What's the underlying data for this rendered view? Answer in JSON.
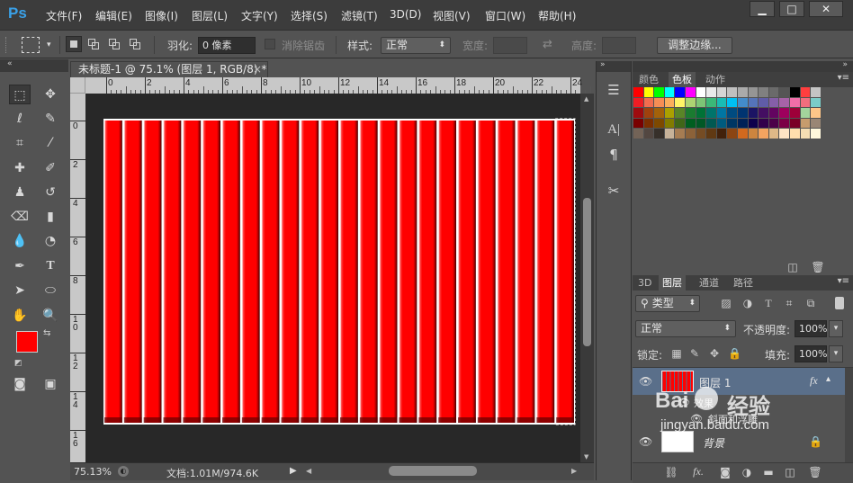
{
  "app": {
    "logo": "Ps"
  },
  "menu": [
    "文件(F)",
    "编辑(E)",
    "图像(I)",
    "图层(L)",
    "文字(Y)",
    "选择(S)",
    "滤镜(T)",
    "3D(D)",
    "视图(V)",
    "窗口(W)",
    "帮助(H)"
  ],
  "window_controls": {
    "minimize": "▁",
    "maximize": "□",
    "close": "✕"
  },
  "options": {
    "feather_label": "羽化:",
    "feather_value": "0 像素",
    "antialias_label": "消除锯齿",
    "style_label": "样式:",
    "style_value": "正常",
    "width_label": "宽度:",
    "height_label": "高度:",
    "refine_edge": "调整边缘..."
  },
  "document": {
    "tab_title": "未标题-1 @ 75.1% (图层 1, RGB/8) *",
    "zoom": "75.13%",
    "doc_info": "文档:1.01M/974.6K",
    "ruler_h": [
      "0",
      "2",
      "4",
      "6",
      "8",
      "10",
      "12",
      "14",
      "16",
      "18",
      "20",
      "22",
      "24"
    ],
    "ruler_v": [
      "0",
      "2",
      "4",
      "6",
      "8",
      "1 0",
      "1 2",
      "1 4",
      "1 6"
    ],
    "stripe_color": "#ff0000",
    "stripe_count": 24
  },
  "panels": {
    "swatches_tabs": [
      "颜色",
      "色板",
      "动作"
    ],
    "layers_tabs": [
      "3D",
      "图层",
      "通道",
      "路径"
    ],
    "kind_filter": "类型",
    "blend_mode": "正常",
    "opacity_label": "不透明度:",
    "opacity_value": "100%",
    "lock_label": "锁定:",
    "fill_label": "填充:",
    "fill_value": "100%",
    "layers": [
      {
        "name": "图层 1",
        "fx": "fx"
      },
      {
        "name": "效果"
      },
      {
        "name": "斜面和浮雕"
      },
      {
        "name": "背景"
      }
    ]
  },
  "colors": {
    "foreground": "#ff0000",
    "background": "#ffffff",
    "swatches": [
      "#ff0000",
      "#ffff00",
      "#00ff00",
      "#00ffff",
      "#0000ff",
      "#ff00ff",
      "#ffffff",
      "#eaeaea",
      "#d5d5d5",
      "#c0c0c0",
      "#aaaaaa",
      "#959595",
      "#808080",
      "#6a6a6a",
      "#555555",
      "#000000",
      "#ff3e3e",
      "#c4c4c4",
      "#ee1d24",
      "#f26c4f",
      "#f68e55",
      "#fbaf5c",
      "#fff467",
      "#acd372",
      "#7cc576",
      "#3bb878",
      "#1abbb4",
      "#00bff3",
      "#438ccb",
      "#5574b9",
      "#605ca8",
      "#855fa8",
      "#a763a8",
      "#f06ea9",
      "#f26d7d",
      "#7accc8",
      "#9e0b0f",
      "#a0410d",
      "#a3620a",
      "#aba000",
      "#598527",
      "#1a7b30",
      "#007236",
      "#00746b",
      "#0076a3",
      "#004b80",
      "#003471",
      "#1b1464",
      "#440e62",
      "#630460",
      "#9e005d",
      "#9e0039",
      "#a3d39c",
      "#fdc689",
      "#790000",
      "#7b2e00",
      "#7d4900",
      "#827b00",
      "#406618",
      "#005e20",
      "#005826",
      "#005952",
      "#005b7f",
      "#003663",
      "#002157",
      "#0d004c",
      "#32004b",
      "#4b0049",
      "#7b0046",
      "#7a0026",
      "#c69c6d",
      "#998675",
      "#736357",
      "#534741",
      "#37302a",
      "#c7b299",
      "#a67c52",
      "#8c6239",
      "#754c24",
      "#603913",
      "#42210b",
      "#8b4513",
      "#d2691e",
      "#cd853f",
      "#f4a460",
      "#deb887",
      "#ffe4c4",
      "#ffdead",
      "#f5deb3",
      "#fff8dc"
    ]
  },
  "watermark": {
    "brand": "Bai",
    "brand2": "经验",
    "url": "jingyan.baidu.com"
  }
}
